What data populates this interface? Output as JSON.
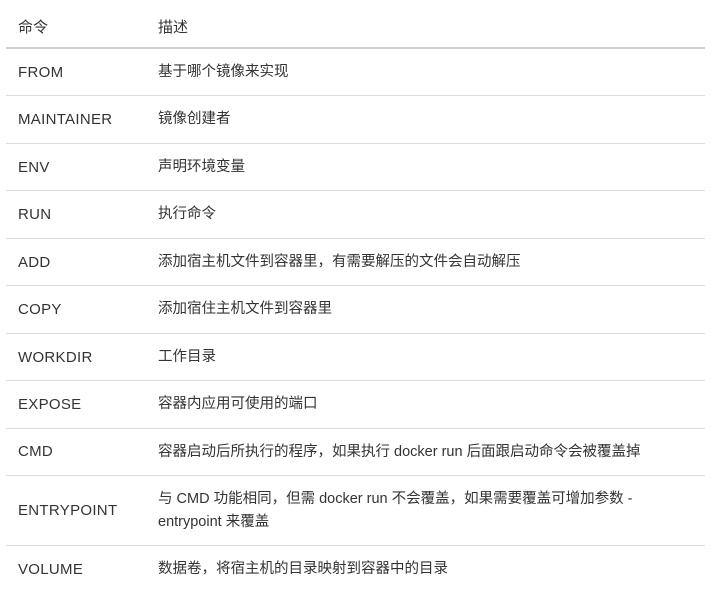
{
  "headers": {
    "command": "命令",
    "description": "描述"
  },
  "rows": [
    {
      "command": "FROM",
      "description": "基于哪个镜像来实现"
    },
    {
      "command": "MAINTAINER",
      "description": "镜像创建者"
    },
    {
      "command": "ENV",
      "description": "声明环境变量"
    },
    {
      "command": "RUN",
      "description": "执行命令"
    },
    {
      "command": "ADD",
      "description": "添加宿主机文件到容器里，有需要解压的文件会自动解压"
    },
    {
      "command": "COPY",
      "description": "添加宿住主机文件到容器里"
    },
    {
      "command": "WORKDIR",
      "description": "工作目录"
    },
    {
      "command": "EXPOSE",
      "description": "容器内应用可使用的端口"
    },
    {
      "command": "CMD",
      "description": "容器启动后所执行的程序，如果执行 docker run 后面跟启动命令会被覆盖掉"
    },
    {
      "command": "ENTRYPOINT",
      "description": "与 CMD 功能相同，但需 docker run 不会覆盖，如果需要覆盖可增加参数 -entrypoint 来覆盖"
    },
    {
      "command": "VOLUME",
      "description": "数据卷，将宿主机的目录映射到容器中的目录"
    }
  ]
}
